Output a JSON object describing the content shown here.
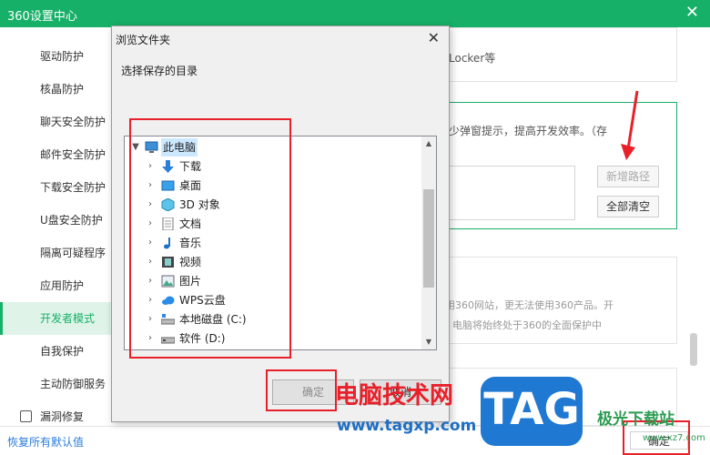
{
  "window": {
    "title": "360设置中心",
    "close": "✕"
  },
  "sidebar": {
    "items": [
      {
        "label": "驱动防护"
      },
      {
        "label": "核晶防护"
      },
      {
        "label": "聊天安全防护"
      },
      {
        "label": "邮件安全防护"
      },
      {
        "label": "下载安全防护"
      },
      {
        "label": "U盘安全防护"
      },
      {
        "label": "隔离可疑程序"
      },
      {
        "label": "应用防护"
      },
      {
        "label": "开发者模式"
      },
      {
        "label": "自我保护"
      },
      {
        "label": "主动防御服务"
      },
      {
        "label": "漏洞修复"
      }
    ],
    "active": "开发者模式"
  },
  "panels": {
    "top_text": "Locker等",
    "mid_text": "少弹窗提示，提高开发效率。（存",
    "add_path_button": "新增路径",
    "clear_all_button": "全部清空",
    "low_text_1": "用360网站，更无法使用360产品。开",
    "low_text_2": "电脑将始终处于360的全面保护中"
  },
  "footer": {
    "restore_defaults": "恢复所有默认值",
    "ok_button": "确定"
  },
  "dialog": {
    "title": "浏览文件夹",
    "close": "✕",
    "prompt": "选择保存的目录",
    "tree": [
      {
        "label": "此电脑",
        "icon": "computer-icon",
        "level": 0,
        "expanded": true,
        "selected": true
      },
      {
        "label": "下载",
        "icon": "download-arrow-icon",
        "level": 1
      },
      {
        "label": "桌面",
        "icon": "desktop-icon",
        "level": 1
      },
      {
        "label": "3D 对象",
        "icon": "3d-object-icon",
        "level": 1
      },
      {
        "label": "文档",
        "icon": "document-icon",
        "level": 1
      },
      {
        "label": "音乐",
        "icon": "music-note-icon",
        "level": 1
      },
      {
        "label": "视频",
        "icon": "video-icon",
        "level": 1
      },
      {
        "label": "图片",
        "icon": "picture-icon",
        "level": 1
      },
      {
        "label": "WPS云盘",
        "icon": "cloud-icon",
        "level": 1
      },
      {
        "label": "本地磁盘 (C:)",
        "icon": "drive-c-icon",
        "level": 1
      },
      {
        "label": "软件 (D:)",
        "icon": "drive-icon",
        "level": 1
      }
    ],
    "ok_button": "确定",
    "cancel_button": "取消"
  },
  "watermark": {
    "site_name": "电脑技术网",
    "site_url": "www.tagxp.com",
    "logo_text": "TAG",
    "corner_text": "极光下载站",
    "corner_url": "www.xz7.com"
  },
  "colors": {
    "brand_green": "#17b068",
    "annotation_red": "#e8202a",
    "link_blue": "#2a7dd9"
  }
}
